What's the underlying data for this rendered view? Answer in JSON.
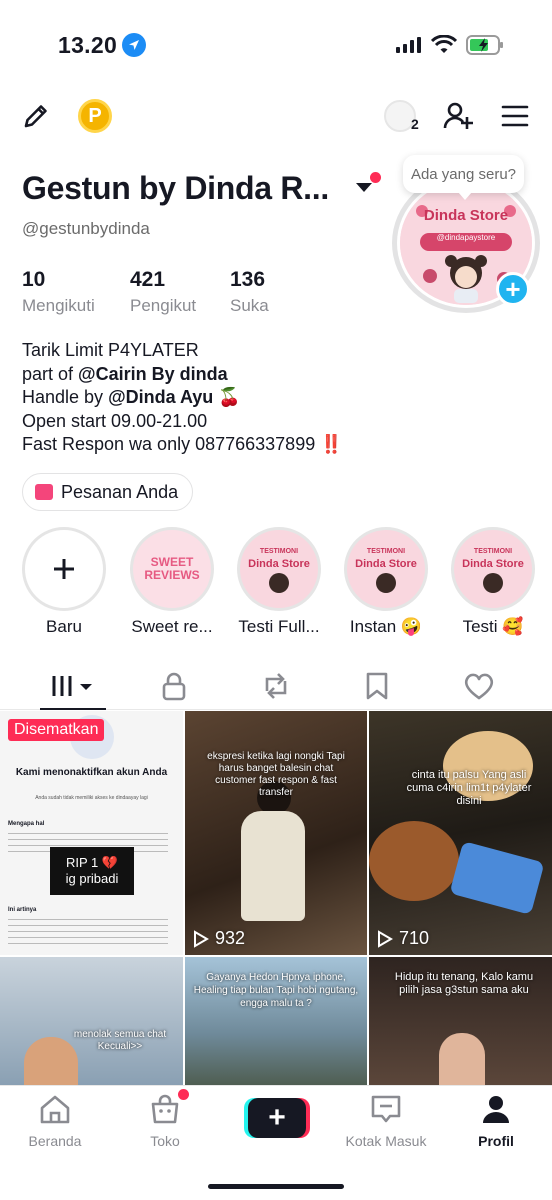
{
  "status_bar": {
    "time": "13.20"
  },
  "friends_count": "2",
  "profile": {
    "name": "Gestun by Dinda R...",
    "username": "@gestunbydinda",
    "stats": [
      {
        "value": "10",
        "label": "Mengikuti"
      },
      {
        "value": "421",
        "label": "Pengikut"
      },
      {
        "value": "136",
        "label": "Suka"
      }
    ],
    "bio": {
      "line1": "Tarik Limit P4YLATER",
      "line2_prefix": "part of ",
      "line2_bold": "@Cairin By dinda",
      "line3_prefix": "Handle by ",
      "line3_bold": "@Dinda Ayu",
      "line3_emoji": "🍒",
      "line4": "Open start 09.00-21.00",
      "line5": "Fast Respon wa only 087766337899",
      "line5_emoji": "‼️"
    },
    "orders_label": "Pesanan Anda",
    "bubble_text": "Ada yang seru?",
    "avatar": {
      "title": "Dinda Store",
      "subtitle": "@dindapaystore"
    }
  },
  "highlights": [
    {
      "label": "Baru",
      "icon": "plus-icon"
    },
    {
      "label": "Sweet re...",
      "cover_title": "SWEET",
      "cover_sub": "REVIEWS"
    },
    {
      "label": "Testi Full...",
      "cover_title": "Dinda Store",
      "cover_sub": "TESTIMONI"
    },
    {
      "label": "Instan 🤪",
      "cover_title": "Dinda Store",
      "cover_sub": "TESTIMONI"
    },
    {
      "label": "Testi 🥰",
      "cover_title": "Dinda Store",
      "cover_sub": "TESTIMONI"
    }
  ],
  "tabs": [
    "videos-grid-icon",
    "lock-icon",
    "repost-icon",
    "bookmark-icon",
    "heart-icon"
  ],
  "videos": [
    {
      "pinned": "Disematkan",
      "title": "Kami menonaktifkan akun Anda",
      "sub": "Anda sudah tidak memiliki akses ke dindaayay lagi",
      "sticker_l1": "RIP 1 💔",
      "sticker_l2": "ig pribadi",
      "section1": "Mengapa hal",
      "section2": "Ini artinya"
    },
    {
      "views": "932",
      "caption": "ekspresi ketika lagi nongki Tapi harus banget balesin chat customer fast respon & fast transfer"
    },
    {
      "views": "710",
      "caption": "cinta itu palsu Yang asli cuma c4irin lim1t p4ylater disini"
    },
    {
      "caption": "menolak semua chat Kecuali>>"
    },
    {
      "caption": "Gayanya Hedon Hpnya iphone, Healing tiap bulan Tapi hobi ngutang, engga malu ta ?"
    },
    {
      "caption": "Hidup itu tenang, Kalo kamu pilih jasa g3stun sama aku"
    }
  ],
  "bottom_nav": {
    "home": "Beranda",
    "shop": "Toko",
    "inbox": "Kotak Masuk",
    "profile": "Profil"
  },
  "colors": {
    "accent": "#fe2c55",
    "cyan": "#25f4ee",
    "badge_blue": "#20b4f0"
  }
}
